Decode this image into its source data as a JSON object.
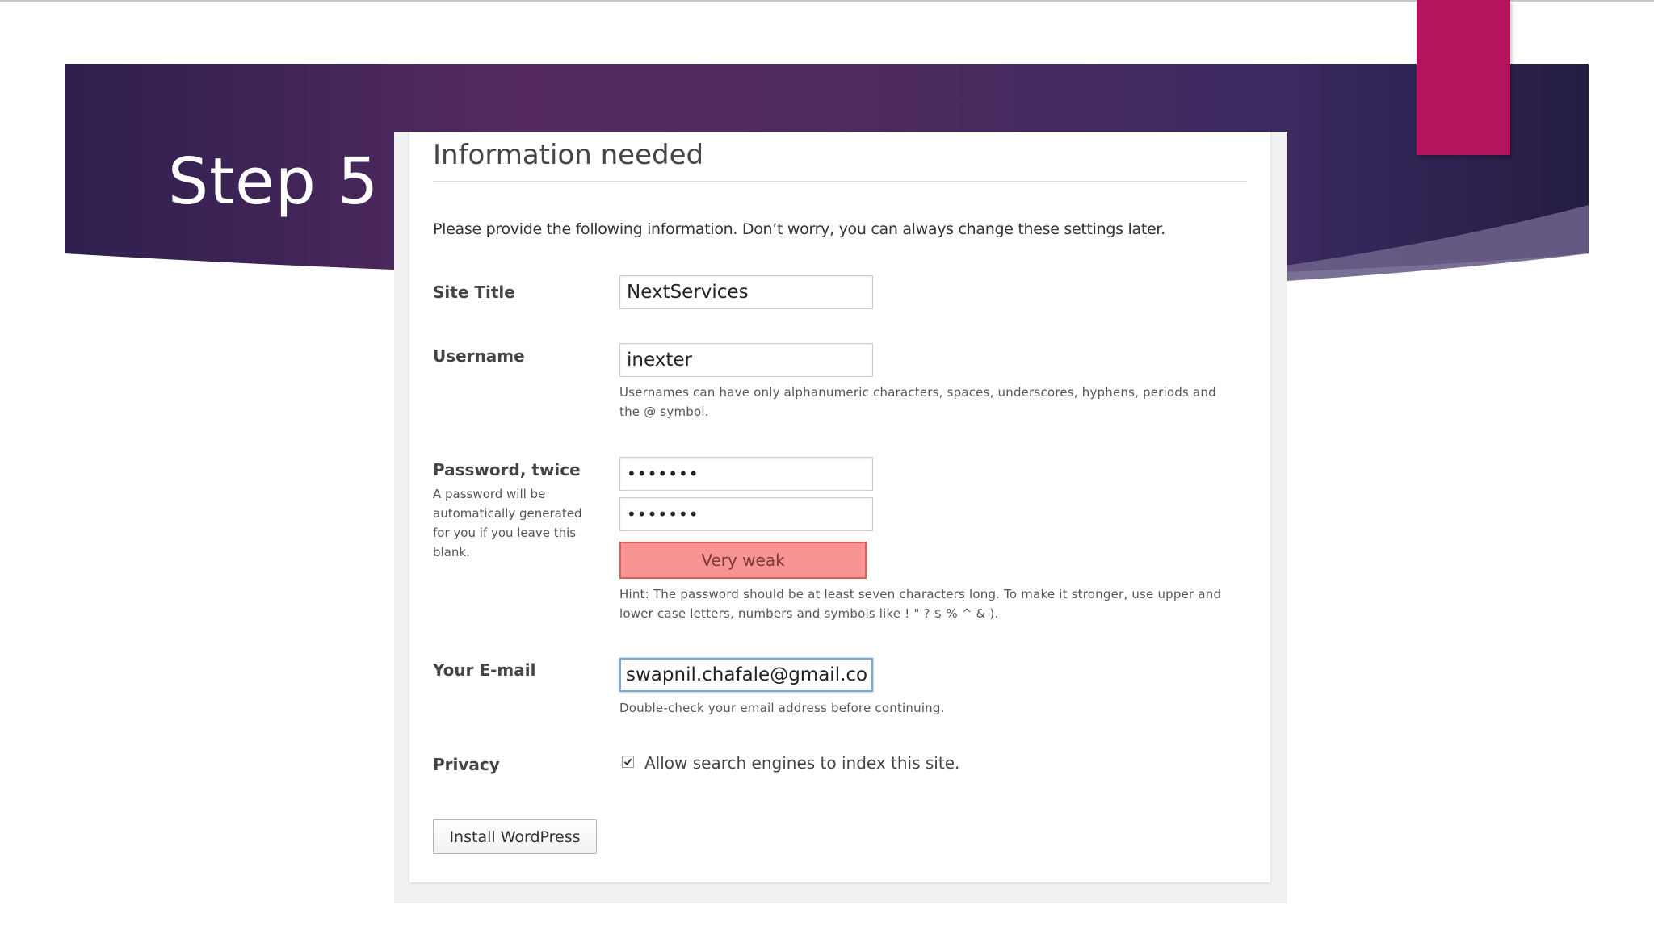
{
  "slide": {
    "title": "Step 5"
  },
  "colors": {
    "banner_dark": "#2a1d48",
    "banner_mid": "#5a2d64",
    "accent_tab": "#b5135e",
    "strength_fill": "#f79393",
    "strength_border": "#e35b5b",
    "focus_border": "#7fa6d6"
  },
  "form": {
    "heading": "Information needed",
    "intro": "Please provide the following information. Don’t worry, you can always change these settings later.",
    "site_title": {
      "label": "Site Title",
      "value": "NextServices"
    },
    "username": {
      "label": "Username",
      "value": "inexter",
      "hint_line1": "Usernames can have only alphanumeric characters, spaces, underscores, hyphens, periods and",
      "hint_line2": "the @ symbol."
    },
    "password": {
      "label": "Password, twice",
      "side_hint_lines": [
        "A password will be",
        "automatically generated",
        "for you if you leave this",
        "blank."
      ],
      "value1": "•••••••",
      "value2": "•••••••",
      "strength": "Very weak",
      "hint_line1": "Hint: The password should be at least seven characters long. To make it stronger, use upper and",
      "hint_line2": "lower case letters, numbers and symbols like ! \" ? $ % ^ & )."
    },
    "email": {
      "label": "Your E-mail",
      "value": "swapnil.chafale@gmail.com",
      "hint": "Double-check your email address before continuing."
    },
    "privacy": {
      "label": "Privacy",
      "checked": true,
      "checkbox_label": "Allow search engines to index this site.",
      "check_icon": "checkmark-icon"
    },
    "submit_label": "Install WordPress"
  }
}
